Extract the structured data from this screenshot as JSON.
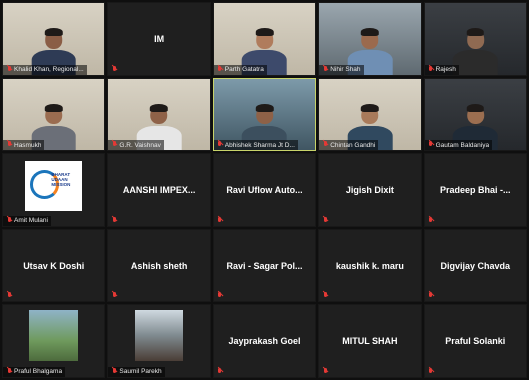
{
  "participants": [
    {
      "name": "Khalid Khan, Regional...",
      "kind": "video",
      "scene": "wall-light",
      "shirt": "#2e3b55",
      "skin": "#8a5d45"
    },
    {
      "name": "IM",
      "kind": "name"
    },
    {
      "name": "Parth Gatatra",
      "kind": "video",
      "scene": "wall-light",
      "shirt": "#3d4a6b",
      "skin": "#b07c5c"
    },
    {
      "name": "Nihir Shah",
      "kind": "video",
      "scene": "wall-office",
      "shirt": "#6f8fb4",
      "skin": "#9b6a4d"
    },
    {
      "name": "Rajesh",
      "kind": "video",
      "scene": "wall-dark",
      "shirt": "#2b2b2b",
      "skin": "#8f6a52"
    },
    {
      "name": "Hasmukh",
      "kind": "video",
      "scene": "wall-light",
      "shirt": "#6b6f78",
      "skin": "#9a6c50"
    },
    {
      "name": "G.R. Vaishnav",
      "kind": "video",
      "scene": "wall-light",
      "shirt": "#e6e6e6",
      "skin": "#8f6248"
    },
    {
      "name": "Abhishek Sharma Jt D...",
      "kind": "video",
      "scene": "wall-blue",
      "shirt": "#3c4f5e",
      "skin": "#8e6147",
      "active": true
    },
    {
      "name": "Chintan Gandhi",
      "kind": "video",
      "scene": "wall-light",
      "shirt": "#30495f",
      "skin": "#a87a5a"
    },
    {
      "name": "Gautam Baldaniya",
      "kind": "video",
      "scene": "wall-dark",
      "shirt": "#1f2a36",
      "skin": "#9b6e50"
    },
    {
      "name": "Amit Mulani",
      "kind": "poster",
      "poster_text": "BHARAT UDAAN MISSION"
    },
    {
      "name": "AANSHI IMPEX...",
      "kind": "name"
    },
    {
      "name": "Ravi Uflow Auto...",
      "kind": "name"
    },
    {
      "name": "Jigish Dixit",
      "kind": "name"
    },
    {
      "name": "Pradeep Bhai -...",
      "kind": "name"
    },
    {
      "name": "Utsav K Doshi",
      "kind": "name"
    },
    {
      "name": "Ashish sheth",
      "kind": "name"
    },
    {
      "name": "Ravi - Sagar Pol...",
      "kind": "name"
    },
    {
      "name": "kaushik k. maru",
      "kind": "name"
    },
    {
      "name": "Digvijay Chavda",
      "kind": "name"
    },
    {
      "name": "Praful Bhalgama",
      "kind": "photo",
      "style": "photo"
    },
    {
      "name": "Saumil Parekh",
      "kind": "photo",
      "style": "photo crowd"
    },
    {
      "name": "Jayprakash Goel",
      "kind": "name"
    },
    {
      "name": "MITUL SHAH",
      "kind": "name"
    },
    {
      "name": "Praful Solanki",
      "kind": "name"
    }
  ],
  "colors": {
    "tile_background": "#1f1f1f",
    "active_border": "#c8d36a",
    "mute_icon": "#e53935"
  }
}
